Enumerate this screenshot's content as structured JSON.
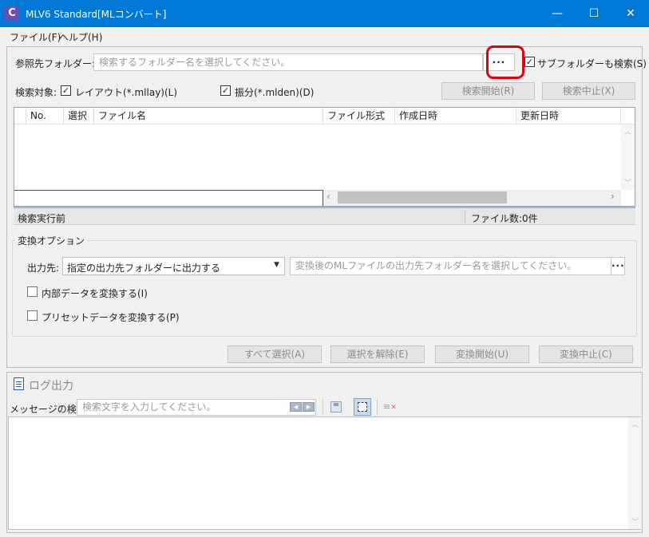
{
  "window": {
    "title": "MLV6 Standard[MLコンバート]",
    "app_icon_letter": "C",
    "minimize": "—",
    "maximize": "☐",
    "close": "✕"
  },
  "menu": {
    "file": "ファイル(F)",
    "help": "ヘルプ(H)"
  },
  "search": {
    "folder_label": "参照先フォルダー:",
    "folder_placeholder": "検索するフォルダー名を選択してください。",
    "browse": "···",
    "subfolder_label": "サブフォルダーも検索(S)",
    "subfolder_checked": true,
    "target_label": "検索対象:",
    "layout_label": "レイアウト(*.mllay)(L)",
    "layout_checked": true,
    "split_label": "振分(*.mlden)(D)",
    "split_checked": true,
    "start_button": "検索開始(R)",
    "stop_button": "検索中止(X)"
  },
  "grid": {
    "columns": [
      "No.",
      "選択",
      "ファイル名",
      "ファイル形式",
      "作成日時",
      "更新日時"
    ],
    "rows": []
  },
  "status": {
    "left": "検索実行前",
    "right": "ファイル数:0件"
  },
  "convert": {
    "group_label": "変換オプション",
    "output_label": "出力先:",
    "output_selected": "指定の出力先フォルダーに出力する",
    "output_placeholder": "変換後のMLファイルの出力先フォルダー名を選択してください。",
    "browse": "···",
    "internal_label": "内部データを変換する(I)",
    "internal_checked": false,
    "preset_label": "プリセットデータを変換する(P)",
    "preset_checked": false
  },
  "actions": {
    "select_all": "すべて選択(A)",
    "deselect": "選択を解除(E)",
    "convert_start": "変換開始(U)",
    "convert_stop": "変換中止(C)"
  },
  "log": {
    "title": "ログ出力",
    "search_label": "メッセージの検索:",
    "search_placeholder": "検索文字を入力してください。"
  },
  "colors": {
    "titlebar": "#0078d7",
    "highlight": "#e0000f"
  }
}
